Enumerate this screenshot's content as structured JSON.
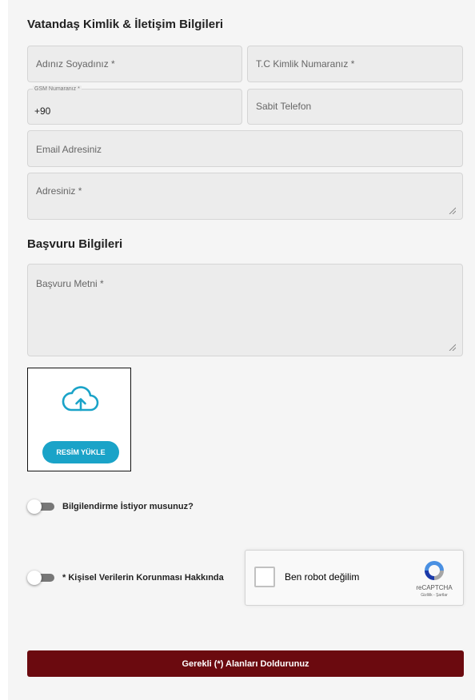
{
  "sections": {
    "identity_title": "Vatandaş Kimlik & İletişim Bilgileri",
    "application_title": "Başvuru Bilgileri"
  },
  "fields": {
    "full_name": {
      "placeholder": "Adınız Soyadınız *"
    },
    "tc_number": {
      "placeholder": "T.C Kimlik Numaranız *"
    },
    "gsm": {
      "legend": "GSM Numaranız *",
      "value": "+90"
    },
    "landline": {
      "placeholder": "Sabit Telefon"
    },
    "email": {
      "placeholder": "Email Adresiniz"
    },
    "address": {
      "placeholder": "Adresiniz *"
    },
    "application_text": {
      "placeholder": "Başvuru Metni *"
    }
  },
  "upload": {
    "icon": "cloud-upload-icon",
    "button_label": "RESİM YÜKLE",
    "accent_color": "#1aa3c8"
  },
  "toggles": {
    "notification": {
      "label": "Bilgilendirme İstiyor musunuz?",
      "on": false
    },
    "kvkk": {
      "label": "* Kişisel Verilerin Korunması Hakkında",
      "on": false
    }
  },
  "captcha": {
    "label": "Ben robot değilim",
    "brand": "reCAPTCHA",
    "terms": "Gizlilik - Şartlar",
    "checked": false
  },
  "submit": {
    "label": "Gerekli (*) Alanları Doldurunuz",
    "color": "#6b0a0f"
  }
}
